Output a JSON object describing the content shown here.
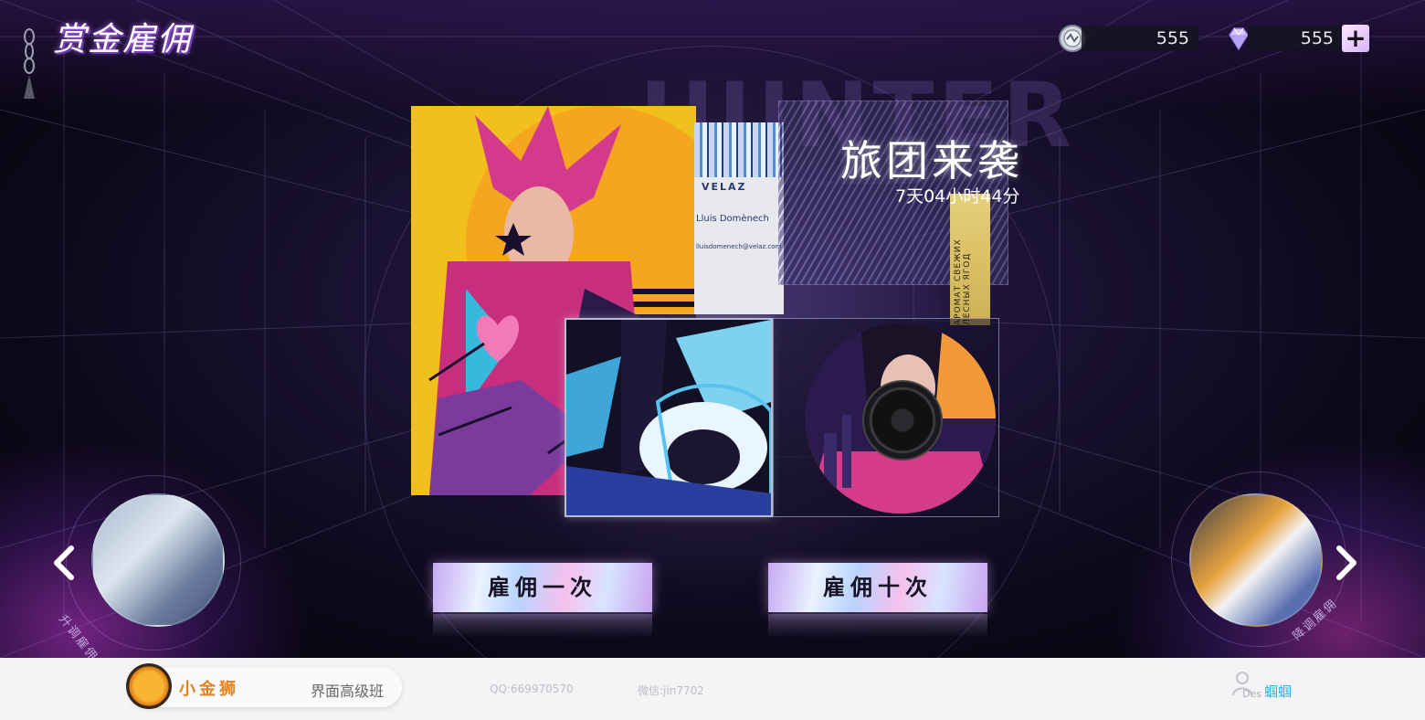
{
  "header": {
    "title": "赏金雇佣",
    "currency": {
      "coin_value": "555",
      "coin_icon": "silver-coin-icon",
      "gem_value": "555",
      "gem_icon": "diamond-gem-icon",
      "add_label": "+"
    }
  },
  "event": {
    "title": "旅团来袭",
    "timer": "7天04小时44分",
    "card_brand": "VELAZ",
    "card_person": "Lluis Domènech",
    "card_email": "lluisdomenech@velaz.com",
    "background_word": "HUNTER",
    "strip_text": "АРОМАТ СВЕЖИХ ЛЕСНЫХ ЯГОД"
  },
  "side": {
    "left_label": "升调雇佣",
    "right_label": "降调雇佣"
  },
  "actions": {
    "hire_once": "雇佣一次",
    "hire_ten": "雇佣十次"
  },
  "footer": {
    "brand_name": "小金狮",
    "course": "界面高级班",
    "qq": "QQ:669970570",
    "wechat": "微信:jin7702",
    "user_des": "Des",
    "user_name": "蝈蝈"
  },
  "colors": {
    "accent_purple": "#8a5cf0",
    "brand_orange": "#e8811d",
    "user_blue": "#26b6e8"
  }
}
